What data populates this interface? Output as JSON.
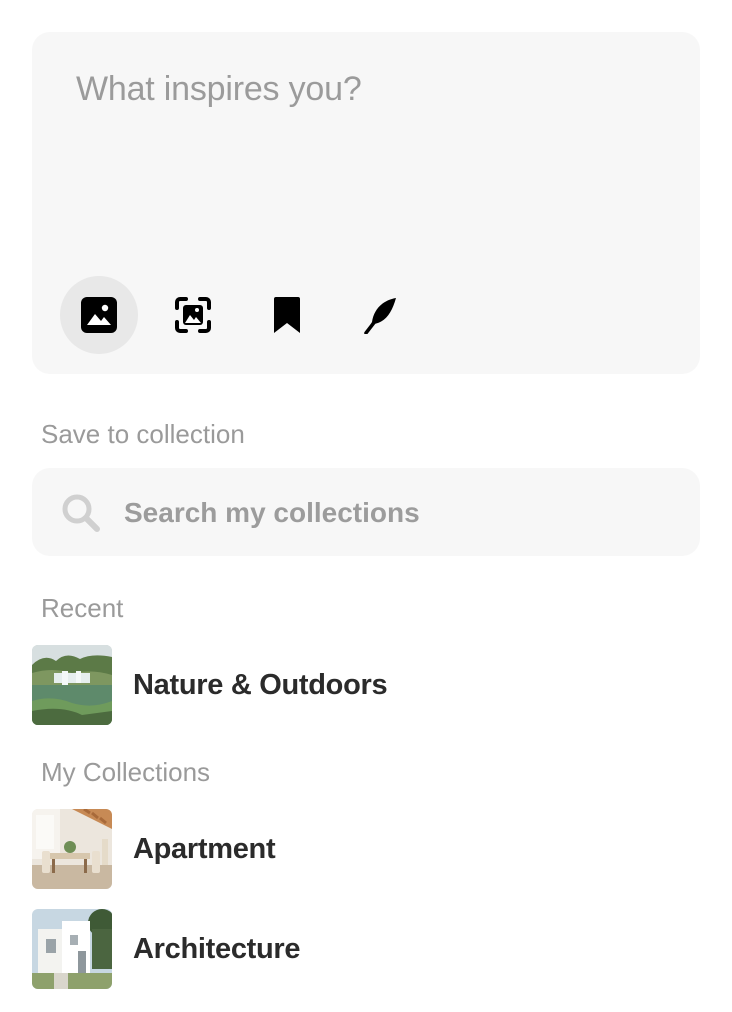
{
  "composer": {
    "placeholder": "What inspires you?",
    "tools": [
      {
        "icon": "image-icon",
        "active": true
      },
      {
        "icon": "scan-image-icon",
        "active": false
      },
      {
        "icon": "bookmark-icon",
        "active": false
      },
      {
        "icon": "quill-icon",
        "active": false
      }
    ]
  },
  "save_section": {
    "label": "Save to collection",
    "search_placeholder": "Search my collections"
  },
  "recent": {
    "label": "Recent",
    "items": [
      {
        "name": "Nature & Outdoors",
        "thumb": "waterfall-landscape"
      }
    ]
  },
  "my_collections": {
    "label": "My Collections",
    "items": [
      {
        "name": "Apartment",
        "thumb": "dining-room-interior"
      },
      {
        "name": "Architecture",
        "thumb": "white-building"
      }
    ]
  }
}
